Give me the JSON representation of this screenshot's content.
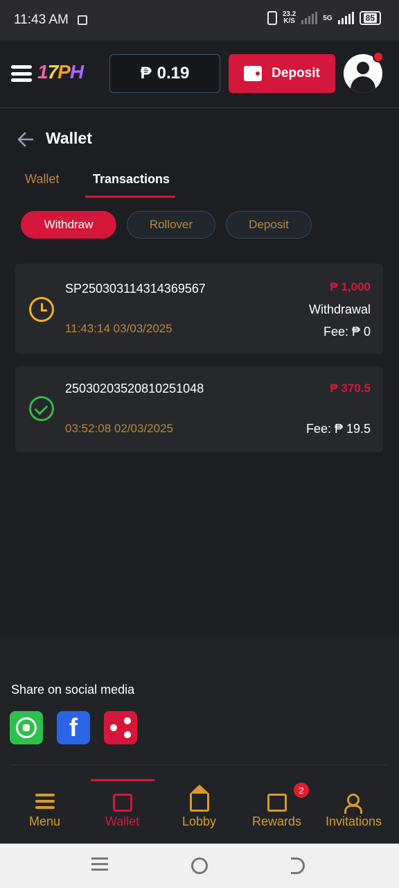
{
  "status_bar": {
    "time": "11:43 AM",
    "speed_value": "23.2",
    "speed_unit": "K/S",
    "network": "5G",
    "battery": "85"
  },
  "header": {
    "logo": [
      "1",
      "7",
      "P",
      "H"
    ],
    "balance_symbol": "₱",
    "balance_value": "0.19",
    "deposit_label": "Deposit"
  },
  "page": {
    "title": "Wallet"
  },
  "tabs": [
    {
      "label": "Wallet",
      "active": false
    },
    {
      "label": "Transactions",
      "active": true
    }
  ],
  "filters": [
    {
      "label": "Withdraw",
      "active": true
    },
    {
      "label": "Rollover",
      "active": false
    },
    {
      "label": "Deposit",
      "active": false
    }
  ],
  "transactions": [
    {
      "id": "SP250303114314369567",
      "amount": "₱ 1,000",
      "type": "Withdrawal",
      "fee": "Fee: ₱ 0",
      "datetime": "11:43:14 03/03/2025",
      "status": "pending",
      "status_icon": "clock-icon"
    },
    {
      "id": "25030203520810251048",
      "amount": "₱ 370.5",
      "fee": "Fee: ₱ 19.5",
      "datetime": "03:52:08 02/03/2025",
      "status": "success",
      "status_icon": "check-circle-icon"
    }
  ],
  "share": {
    "title": "Share on social media",
    "facebook_glyph": "f"
  },
  "bottom_nav": [
    {
      "label": "Menu",
      "icon": "menu-icon",
      "active": false
    },
    {
      "label": "Wallet",
      "icon": "wallet-icon",
      "active": true
    },
    {
      "label": "Lobby",
      "icon": "home-icon",
      "active": false
    },
    {
      "label": "Rewards",
      "icon": "gift-icon",
      "active": false,
      "badge": "2"
    },
    {
      "label": "Invitations",
      "icon": "add-user-icon",
      "active": false
    }
  ],
  "colors": {
    "accent": "#d5173b",
    "gold": "#b8893a",
    "pending": "#f2b11c",
    "success": "#3bb54a",
    "background": "#1c1e22"
  }
}
